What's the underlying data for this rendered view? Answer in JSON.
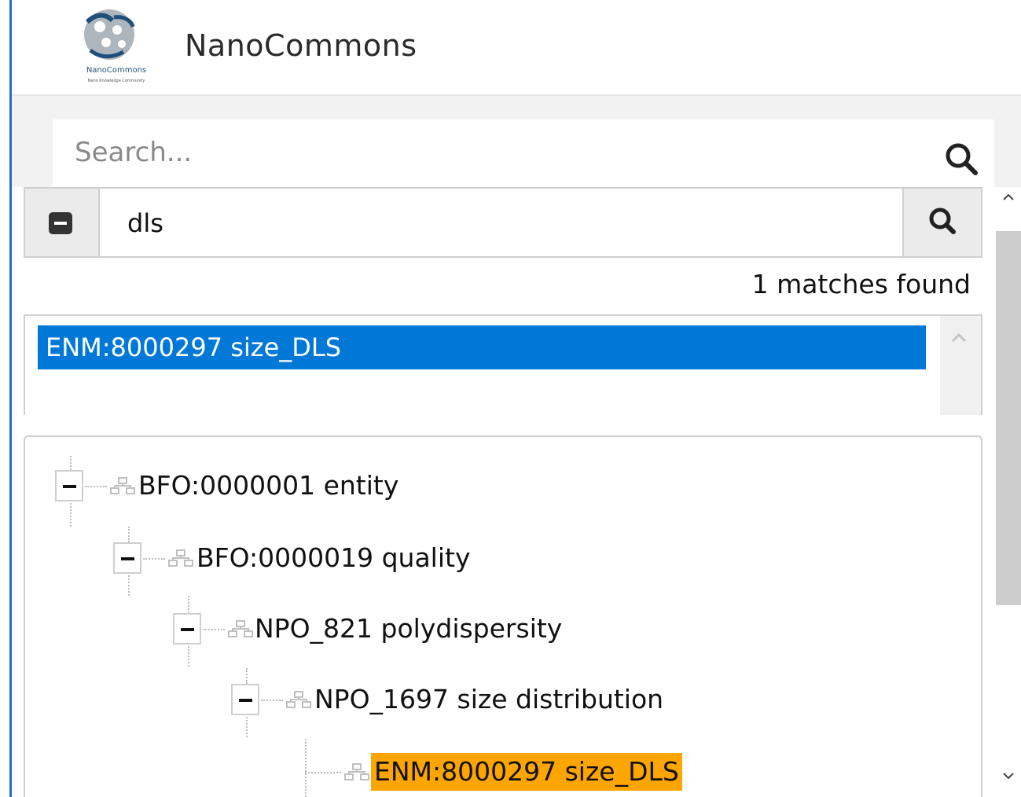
{
  "header": {
    "title": "NanoCommons",
    "logo_text": "NanoCommons",
    "logo_subtext": "Nano Knowledge Community"
  },
  "search": {
    "placeholder": "Search...",
    "value": "",
    "icon": "magnifier-icon"
  },
  "filter": {
    "collapse_icon": "minus-square-icon",
    "value": "dls",
    "search_icon": "magnifier-icon"
  },
  "matches_text": "1 matches found",
  "results": [
    {
      "label": "ENM:8000297 size_DLS",
      "selected": true
    }
  ],
  "tree": {
    "nodes": [
      {
        "label": "BFO:0000001 entity",
        "depth": 0,
        "expanded": true,
        "highlighted": false
      },
      {
        "label": "BFO:0000019 quality",
        "depth": 1,
        "expanded": true,
        "highlighted": false
      },
      {
        "label": "NPO_821 polydispersity",
        "depth": 2,
        "expanded": true,
        "highlighted": false
      },
      {
        "label": "NPO_1697 size distribution",
        "depth": 3,
        "expanded": true,
        "highlighted": false
      },
      {
        "label": "ENM:8000297 size_DLS",
        "depth": 4,
        "expanded": false,
        "highlighted": true
      }
    ]
  },
  "colors": {
    "accent": "#1e6fc9",
    "selected": "#0078d7",
    "highlight": "#ffa500"
  }
}
